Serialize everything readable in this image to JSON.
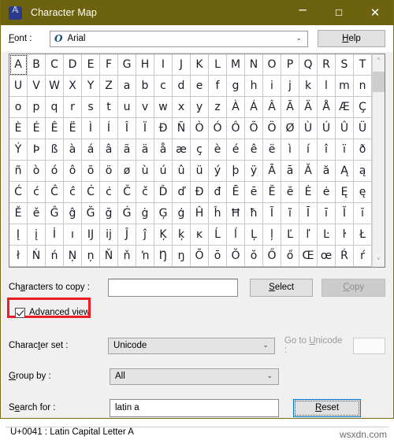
{
  "window": {
    "title": "Character Map",
    "icon": "character-map-icon",
    "minimize": "─",
    "maximize": "☐",
    "close": "✕"
  },
  "font": {
    "label": "Font :",
    "label_mnemonic": "F",
    "value": "Arial",
    "glyph": "O",
    "arrow": "⌄"
  },
  "help": {
    "label": "Help",
    "mnemonic": "H"
  },
  "grid": {
    "selected_index": 0,
    "columns": 20,
    "scroll": {
      "up": "˄",
      "down": "˅"
    },
    "characters": [
      "A",
      "B",
      "C",
      "D",
      "E",
      "F",
      "G",
      "H",
      "I",
      "J",
      "K",
      "L",
      "M",
      "N",
      "O",
      "P",
      "Q",
      "R",
      "S",
      "T",
      "U",
      "V",
      "W",
      "X",
      "Y",
      "Z",
      "a",
      "b",
      "c",
      "d",
      "e",
      "f",
      "g",
      "h",
      "i",
      "j",
      "k",
      "l",
      "m",
      "n",
      "o",
      "p",
      "q",
      "r",
      "s",
      "t",
      "u",
      "v",
      "w",
      "x",
      "y",
      "z",
      "À",
      "Á",
      "Â",
      "Ã",
      "Ä",
      "Å",
      "Æ",
      "Ç",
      "È",
      "É",
      "Ê",
      "Ë",
      "Ì",
      "Í",
      "Î",
      "Ï",
      "Ð",
      "Ñ",
      "Ò",
      "Ó",
      "Ô",
      "Õ",
      "Ö",
      "Ø",
      "Ù",
      "Ú",
      "Û",
      "Ü",
      "Ý",
      "Þ",
      "ß",
      "à",
      "á",
      "â",
      "ã",
      "ä",
      "å",
      "æ",
      "ç",
      "è",
      "é",
      "ê",
      "ë",
      "ì",
      "í",
      "î",
      "ï",
      "ð",
      "ñ",
      "ò",
      "ó",
      "ô",
      "õ",
      "ö",
      "ø",
      "ù",
      "ú",
      "û",
      "ü",
      "ý",
      "þ",
      "ÿ",
      "Ā",
      "ā",
      "Ă",
      "ă",
      "Ą",
      "ą",
      "Ć",
      "ć",
      "Ĉ",
      "ĉ",
      "Ċ",
      "ċ",
      "Č",
      "č",
      "Ď",
      "ď",
      "Đ",
      "đ",
      "Ē",
      "ē",
      "Ĕ",
      "ĕ",
      "Ė",
      "ė",
      "Ę",
      "ę",
      "Ě",
      "ě",
      "Ĝ",
      "ĝ",
      "Ğ",
      "ğ",
      "Ġ",
      "ġ",
      "Ģ",
      "ģ",
      "Ĥ",
      "ĥ",
      "Ħ",
      "ħ",
      "Ĩ",
      "ĩ",
      "Ī",
      "ī",
      "Ĭ",
      "ĭ",
      "Į",
      "į",
      "İ",
      "ı",
      "Ĳ",
      "ĳ",
      "Ĵ",
      "ĵ",
      "Ķ",
      "ķ",
      "ĸ",
      "Ĺ",
      "ĺ",
      "Ļ",
      "ļ",
      "Ľ",
      "ľ",
      "Ŀ",
      "ŀ",
      "Ł",
      "ł",
      "Ń",
      "ń",
      "Ņ",
      "ņ",
      "Ň",
      "ň",
      "ŉ",
      "Ŋ",
      "ŋ",
      "Ō",
      "ō",
      "Ŏ",
      "ŏ",
      "Ő",
      "ő",
      "Œ",
      "œ",
      "Ŕ",
      "ŕ"
    ]
  },
  "copy": {
    "label": "Characters to copy :",
    "label_mnemonic": "a",
    "value": "",
    "select_label": "Select",
    "select_mnemonic": "S",
    "copy_label": "Copy",
    "copy_mnemonic": "C"
  },
  "advanced": {
    "label": "Advanced view",
    "mnemonic": "v",
    "checked": true,
    "highlight_color": "#ec1c24"
  },
  "charset": {
    "label": "Character set :",
    "label_mnemonic": "t",
    "value": "Unicode",
    "goto_label": "Go to Unicode :",
    "goto_mnemonic": "U",
    "goto_value": ""
  },
  "groupby": {
    "label": "Group by :",
    "label_mnemonic": "G",
    "value": "All"
  },
  "search": {
    "label": "Search for :",
    "label_mnemonic": "e",
    "value": "latin a",
    "reset_label": "Reset",
    "reset_mnemonic": "R"
  },
  "status": {
    "text": "U+0041 : Latin Capital Letter A"
  },
  "watermark": {
    "text": "wsxdn.com"
  }
}
